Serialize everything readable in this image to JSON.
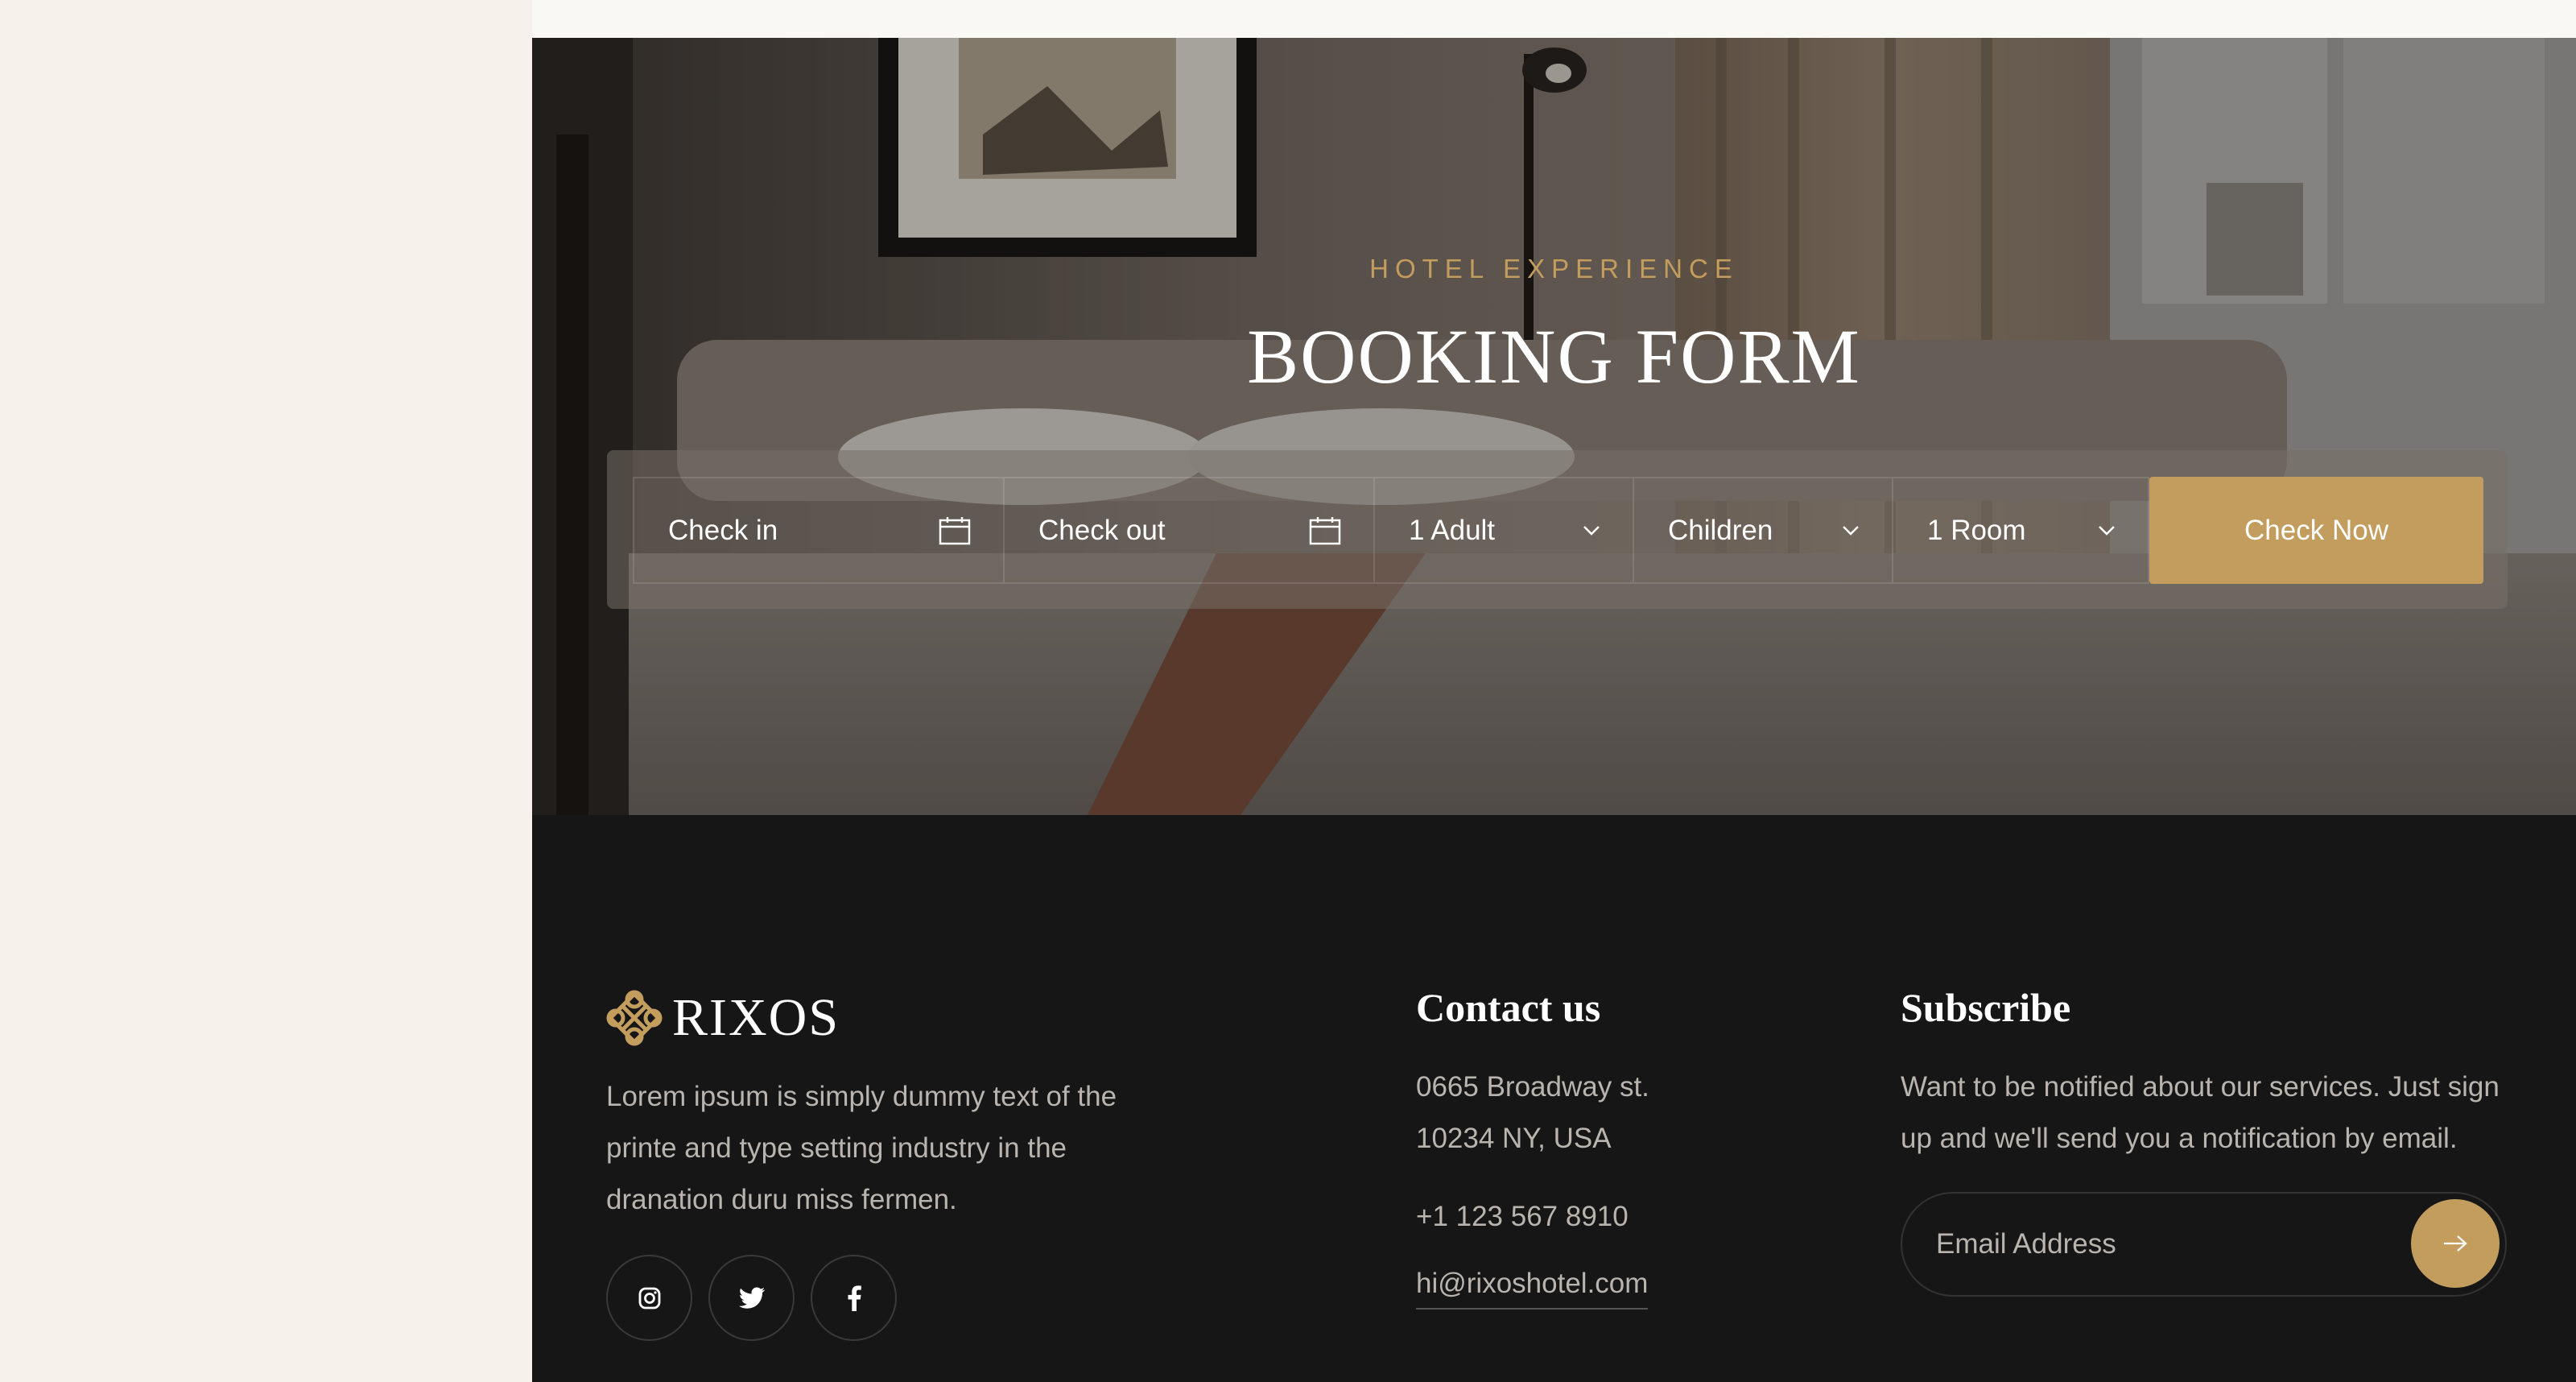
{
  "hero": {
    "eyebrow": "HOTEL EXPERIENCE",
    "title": "BOOKING FORM"
  },
  "booking": {
    "check_in": "Check in",
    "check_out": "Check out",
    "adults": "1 Adult",
    "children": "Children",
    "rooms": "1 Room",
    "submit_label": "Check Now"
  },
  "footer": {
    "brand_name": "RIXOS",
    "about": "Lorem ipsum is simply dummy text of the printe and type setting industry in the dranation duru miss fermen.",
    "contact": {
      "title": "Contact us",
      "address_line1": "0665 Broadway st.",
      "address_line2": "10234 NY, USA",
      "phone": "+1 123 567 8910",
      "email": "hi@rixoshotel.com"
    },
    "subscribe": {
      "title": "Subscribe",
      "text": "Want to be notified about our services. Just sign up and we'll send you a notification by email.",
      "placeholder": "Email Address"
    },
    "socials": [
      "instagram-icon",
      "twitter-icon",
      "facebook-icon"
    ]
  },
  "colors": {
    "accent": "#c39d5e",
    "footer_bg": "#161616",
    "page_bg": "#f6f1ea"
  }
}
